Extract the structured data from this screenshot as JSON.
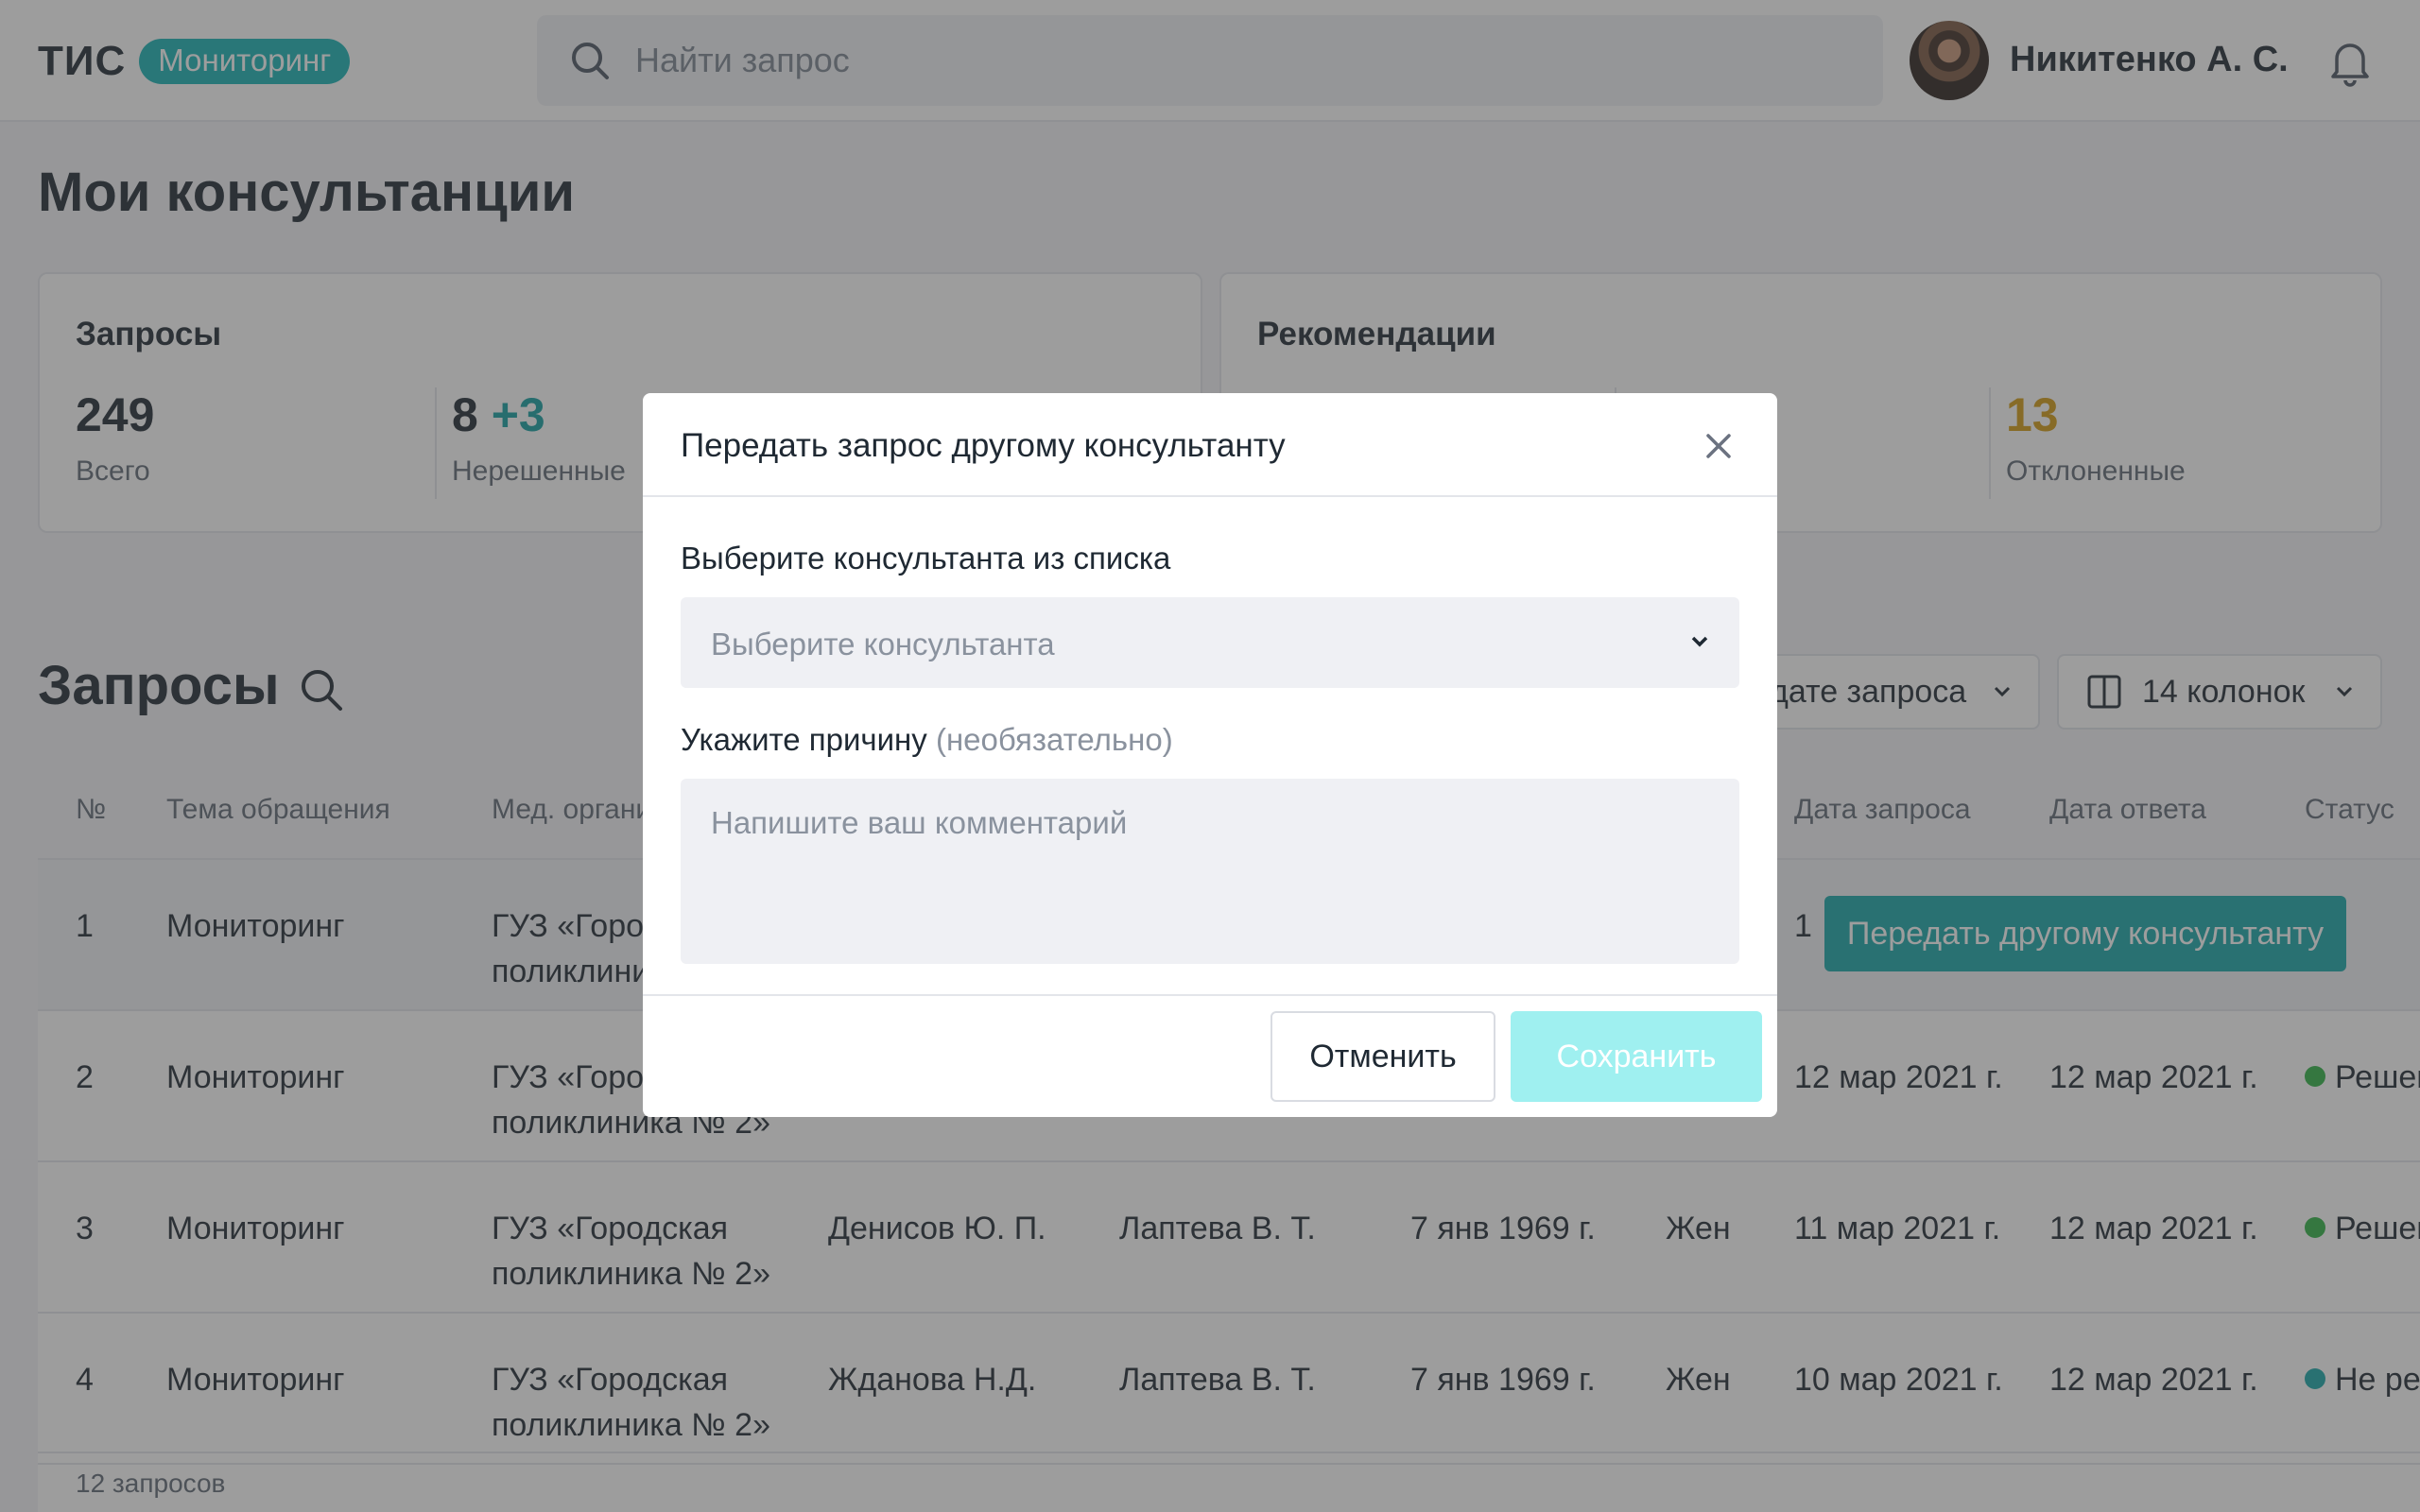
{
  "header": {
    "logo": "ТИС",
    "badge": "Мониторинг",
    "search_placeholder": "Найти запрос",
    "user_name": "Никитенко А. С."
  },
  "page_title": "Мои консультанции",
  "stats_requests": {
    "title": "Запросы",
    "total_value": "249",
    "total_label": "Всего",
    "unresolved_value": "8",
    "unresolved_delta": "+3",
    "unresolved_label": "Нерешенные"
  },
  "stats_recommendations": {
    "title": "Рекомендации",
    "rejected_value": "13",
    "rejected_label": "Отклоненные"
  },
  "requests": {
    "title": "Запросы",
    "sort_label": "дате запроса",
    "columns_label": "14 колонок",
    "headers": {
      "num": "№",
      "topic": "Тема обращения",
      "org": "Мед. органи",
      "date_req": "Дата запроса",
      "date_ans": "Дата ответа",
      "status": "Статус"
    },
    "rows": [
      {
        "num": "1",
        "topic": "Мониторинг",
        "org1": "ГУЗ «Горо",
        "org2": "поликлини",
        "date_req": "1",
        "action": "Передать другому консультанту"
      },
      {
        "num": "2",
        "topic": "Мониторинг",
        "org1": "ГУЗ «Горо",
        "org2": "поликлиника № 2»",
        "date_req": "12 мар 2021 г.",
        "date_ans": "12 мар 2021 г.",
        "status": "Решен"
      },
      {
        "num": "3",
        "topic": "Мониторинг",
        "org1": "ГУЗ «Городская",
        "org2": "поликлиника № 2»",
        "doctor": "Денисов Ю. П.",
        "patient": "Лаптева В. Т.",
        "birth": "7 янв 1969 г.",
        "sex": "Жен",
        "date_req": "11 мар 2021 г.",
        "date_ans": "12 мар 2021 г.",
        "status": "Решен"
      },
      {
        "num": "4",
        "topic": "Мониторинг",
        "org1": "ГУЗ «Городская",
        "org2": "поликлиника № 2»",
        "doctor": "Жданова Н.Д.",
        "patient": "Лаптева В. Т.",
        "birth": "7 янв 1969 г.",
        "sex": "Жен",
        "date_req": "10 мар 2021 г.",
        "date_ans": "12 мар 2021 г.",
        "status": "Не ре"
      }
    ],
    "footer": "12 запросов"
  },
  "modal": {
    "title": "Передать запрос другому консультанту",
    "select_label": "Выберите консультанта из списка",
    "select_placeholder": "Выберите консультанта",
    "reason_label": "Укажите причину",
    "reason_optional": "(необязательно)",
    "comment_placeholder": "Напишите ваш комментарий",
    "cancel_label": "Отменить",
    "save_label": "Сохранить"
  },
  "colors": {
    "accent": "#17b3b5",
    "status_resolved": "#2fb344",
    "status_unresolved": "#17a6a8",
    "rejected": "#d29a12"
  }
}
